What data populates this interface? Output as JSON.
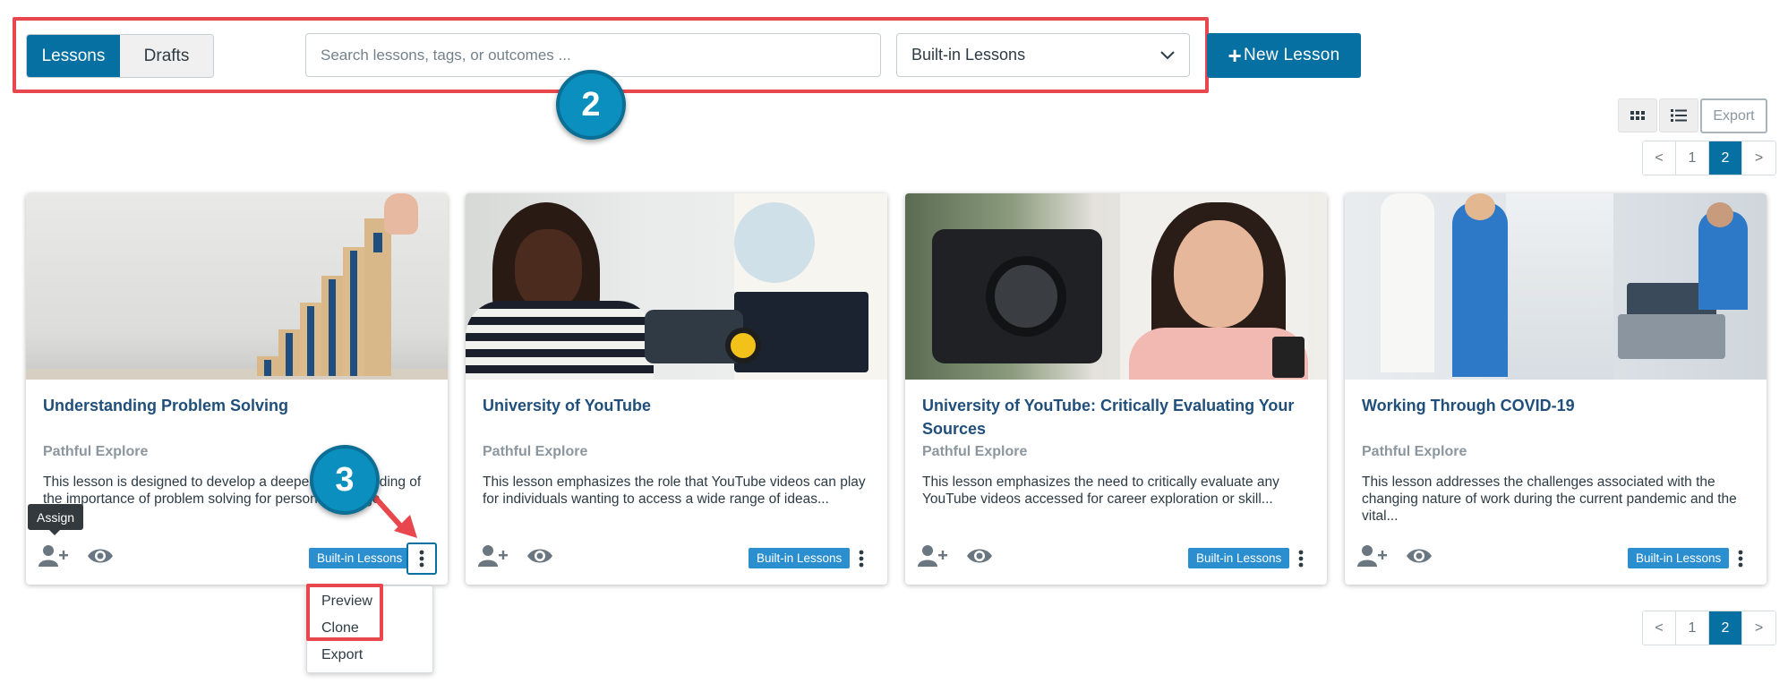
{
  "tabs": {
    "lessons": "Lessons",
    "drafts": "Drafts"
  },
  "search": {
    "placeholder": "Search lessons, tags, or outcomes ..."
  },
  "filter": {
    "selected": "Built-in Lessons"
  },
  "new_lesson": {
    "plus": "+",
    "label": "New Lesson"
  },
  "callouts": {
    "two": "2",
    "three": "3"
  },
  "view": {
    "export": "Export"
  },
  "pagination": {
    "prev": "<",
    "pages": [
      "1",
      "2"
    ],
    "next": ">",
    "current": "2"
  },
  "cards": [
    {
      "title": "Understanding Problem Solving",
      "provider": "Pathful Explore",
      "description": "This lesson is designed to develop a deeper understanding of the importance of problem solving for personal, college,",
      "tag": "Built-in Lessons"
    },
    {
      "title": "University of YouTube",
      "provider": "Pathful Explore",
      "description": "This lesson emphasizes the role that YouTube videos can play for individuals wanting to access a wide range of ideas...",
      "tag": "Built-in Lessons"
    },
    {
      "title": "University of YouTube: Critically Evaluating Your Sources",
      "provider": "Pathful Explore",
      "description": "This lesson emphasizes the need to critically evaluate any YouTube videos accessed for career exploration or skill...",
      "tag": "Built-in Lessons"
    },
    {
      "title": "Working Through COVID-19",
      "provider": "Pathful Explore",
      "description": "This lesson addresses the challenges associated with the changing nature of work during the current pandemic and the vital...",
      "tag": "Built-in Lessons"
    }
  ],
  "tooltip": "Assign",
  "menu": {
    "preview": "Preview",
    "clone": "Clone",
    "export": "Export"
  },
  "colors": {
    "primary": "#0770a3",
    "highlight": "#e8474d",
    "callout": "#0b8fbf",
    "tag": "#2b8fcf"
  }
}
